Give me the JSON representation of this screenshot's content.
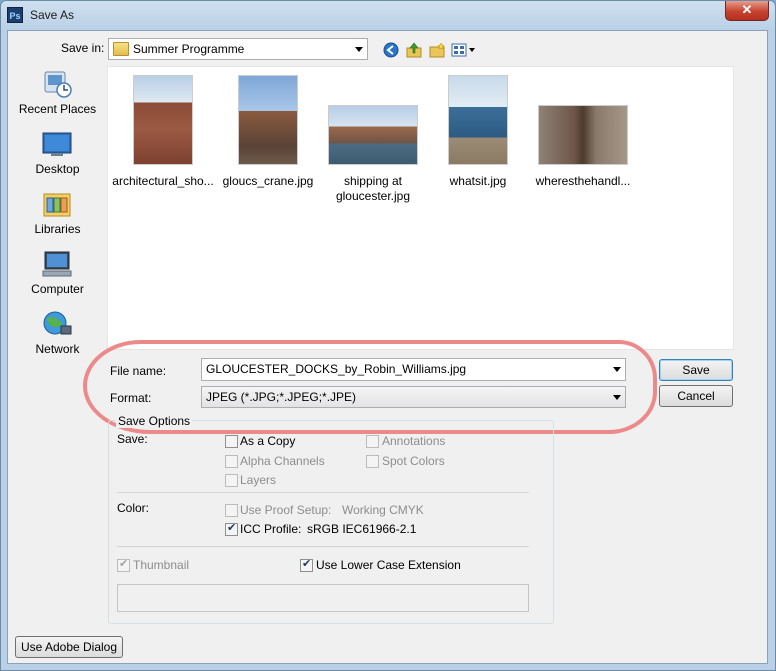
{
  "window": {
    "title": "Save As",
    "app_icon_text": "Ps",
    "close_glyph": "✕"
  },
  "toolbar": {
    "save_in_label": "Save in:",
    "save_in_value": "Summer Programme",
    "icons": [
      "back-icon",
      "up-folder-icon",
      "new-folder-icon",
      "view-menu-icon"
    ]
  },
  "places": [
    {
      "label": "Recent Places",
      "icon": "recent-places-icon"
    },
    {
      "label": "Desktop",
      "icon": "desktop-icon"
    },
    {
      "label": "Libraries",
      "icon": "libraries-icon"
    },
    {
      "label": "Computer",
      "icon": "computer-icon"
    },
    {
      "label": "Network",
      "icon": "network-icon"
    }
  ],
  "files": [
    {
      "name": "architectural_sho..."
    },
    {
      "name": "gloucs_crane.jpg"
    },
    {
      "name": "shipping at\ngloucester.jpg"
    },
    {
      "name": "whatsit.jpg"
    },
    {
      "name": "wheresthehandl..."
    }
  ],
  "form": {
    "filename_label": "File name:",
    "filename_value": "GLOUCESTER_DOCKS_by_Robin_Williams.jpg",
    "format_label": "Format:",
    "format_value": "JPEG (*.JPG;*.JPEG;*.JPE)",
    "save_button": "Save",
    "cancel_button": "Cancel"
  },
  "save_options": {
    "title": "Save Options",
    "save_label": "Save:",
    "as_a_copy": {
      "label": "As a Copy",
      "checked": false,
      "enabled": true
    },
    "alpha_channels": {
      "label": "Alpha Channels",
      "checked": false,
      "enabled": false
    },
    "layers": {
      "label": "Layers",
      "checked": false,
      "enabled": false
    },
    "annotations": {
      "label": "Annotations",
      "checked": false,
      "enabled": false
    },
    "spot_colors": {
      "label": "Spot Colors",
      "checked": false,
      "enabled": false
    },
    "color_label": "Color:",
    "use_proof_setup": {
      "label": "Use Proof Setup:",
      "value": "Working CMYK",
      "checked": false,
      "enabled": false
    },
    "icc_profile": {
      "label": "ICC Profile:",
      "value": "sRGB IEC61966-2.1",
      "checked": true,
      "enabled": true
    },
    "thumbnail": {
      "label": "Thumbnail",
      "checked": true,
      "enabled": false
    },
    "lower_case_ext": {
      "label": "Use Lower Case Extension",
      "checked": true,
      "enabled": true
    }
  },
  "footer": {
    "adobe_dialog_button": "Use Adobe Dialog"
  },
  "colors": {
    "highlight_ring": "#ec8a8a",
    "close_button": "#c7432f"
  }
}
